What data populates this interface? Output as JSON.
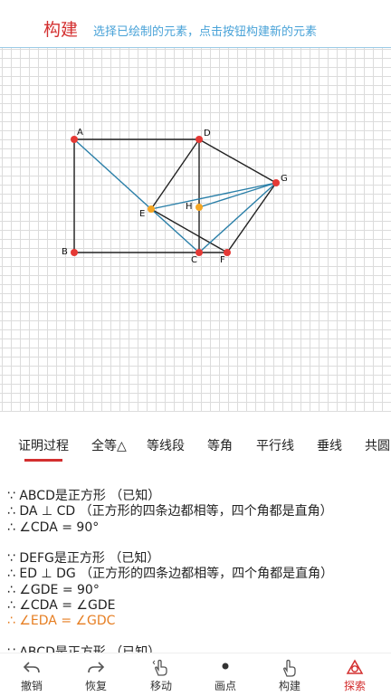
{
  "header": {
    "title": "构建",
    "hint": "选择已绘制的元素，点击按钮构建新的元素"
  },
  "canvas": {
    "points": [
      {
        "name": "A",
        "color": "#e53935"
      },
      {
        "name": "B",
        "color": "#e53935"
      },
      {
        "name": "C",
        "color": "#e53935"
      },
      {
        "name": "D",
        "color": "#e53935"
      },
      {
        "name": "E",
        "color": "#f5a623"
      },
      {
        "name": "F",
        "color": "#e53935"
      },
      {
        "name": "G",
        "color": "#e53935"
      },
      {
        "name": "H",
        "color": "#f5a623"
      }
    ],
    "colors": {
      "black_line": "#222222",
      "blue_line": "#2a7fa8"
    }
  },
  "tabs": {
    "items": [
      "证明过程",
      "全等△",
      "等线段",
      "等角",
      "平行线",
      "垂线",
      "共圆"
    ],
    "active": "证明过程",
    "accent": "#d32f2f"
  },
  "proof": {
    "lines": [
      "∵ ABCD是正方形 （已知）",
      "∴ DA ⊥ CD （正方形的四条边都相等，四个角都是直角）",
      "∴ ∠CDA = 90°",
      "",
      "∵ DEFG是正方形 （已知）",
      "∴ ED ⊥ DG （正方形的四条边都相等，四个角都是直角）",
      "∴ ∠GDE = 90°",
      "∴ ∠CDA = ∠GDE",
      "∴ ∠EDA = ∠GDC",
      "",
      "∵ ABCD是正方形 （已知）"
    ],
    "highlight_color": "#e67e22"
  },
  "toolbar": {
    "items": [
      {
        "label": "撤销",
        "icon": "undo-icon"
      },
      {
        "label": "恢复",
        "icon": "redo-icon"
      },
      {
        "label": "移动",
        "icon": "hand-move-icon"
      },
      {
        "label": "画点",
        "icon": "dot-icon"
      },
      {
        "label": "构建",
        "icon": "hand-pointer-icon"
      },
      {
        "label": "探索",
        "icon": "explore-icon"
      }
    ],
    "active": "探索"
  }
}
